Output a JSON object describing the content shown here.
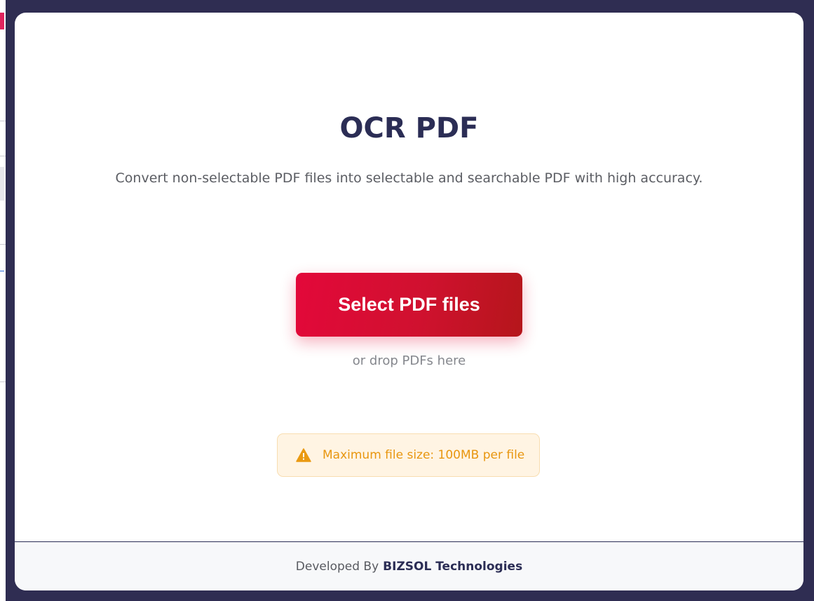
{
  "ocr_tool": {
    "title": "OCR PDF",
    "subtitle": "Convert non-selectable PDF files into selectable and searchable PDF with high accuracy.",
    "select_button_label": "Select PDF files",
    "drop_hint": "or drop PDFs here",
    "notice": {
      "icon": "warning-icon",
      "text": "Maximum file size: 100MB per file"
    }
  },
  "footer": {
    "prefix": "Developed By",
    "brand": "BIZSOL Technologies"
  },
  "colors": {
    "title": "#2b2d55",
    "button": "#d0112f",
    "notice_text": "#e8960f",
    "notice_bg": "#fff4e3",
    "backdrop": "#2f2d52"
  }
}
